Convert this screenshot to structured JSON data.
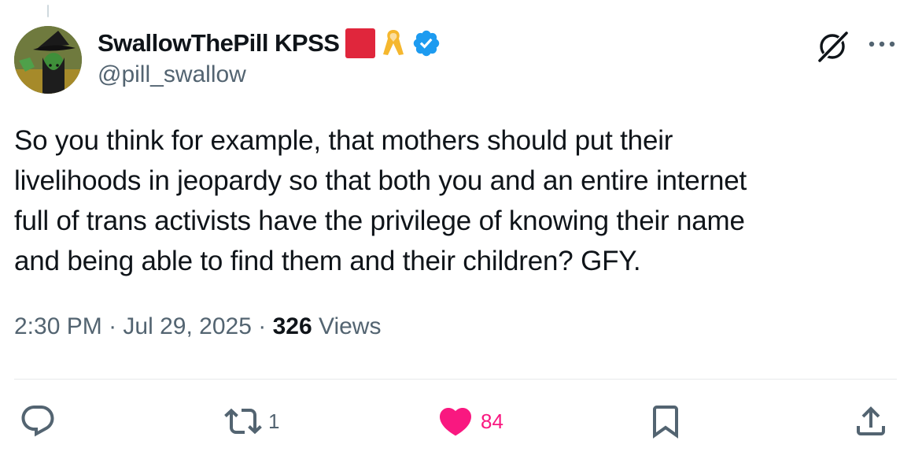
{
  "author": {
    "display_name": "SwallowThePill KPSS",
    "handle": "@pill_swallow",
    "badges": [
      "red-square-icon",
      "ribbon-icon",
      "verified-icon"
    ],
    "colors": {
      "red_square": "#e0263c",
      "ribbon": "#f5b72e",
      "verified": "#1d9bf0"
    }
  },
  "tweet": {
    "text_lines": [
      "So you think for example, that mothers should put their",
      "livelihoods in jeopardy so that both you and an entire internet",
      "full of trans activists have the privilege of knowing their name",
      "and being able to find them and their children? GFY."
    ],
    "time": "2:30 PM",
    "separator": "·",
    "date": "Jul 29, 2025",
    "views_count": "326",
    "views_label": "Views"
  },
  "actions": {
    "reply_count": "",
    "retweet_count": "1",
    "like_count": "84",
    "liked": true,
    "like_color": "#f91880"
  },
  "top_icons": [
    "grok-icon",
    "more-icon"
  ]
}
